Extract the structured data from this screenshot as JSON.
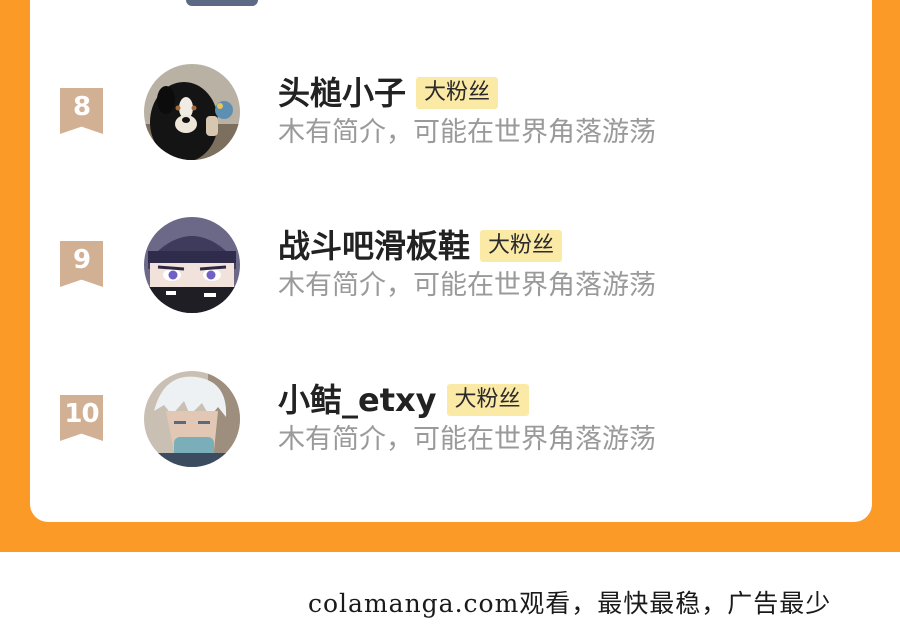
{
  "ranking": {
    "entries": [
      {
        "rank": "8",
        "name": "头槌小子",
        "badge": "大粉丝",
        "bio": "木有简介，可能在世界角落游荡",
        "avatar_icon": "dog-avatar-icon"
      },
      {
        "rank": "9",
        "name": "战斗吧滑板鞋",
        "badge": "大粉丝",
        "bio": "木有简介，可能在世界角落游荡",
        "avatar_icon": "anime-boy-beanie-avatar-icon"
      },
      {
        "rank": "10",
        "name": "小鲒_etxy",
        "badge": "大粉丝",
        "bio": "木有简介，可能在世界角落游荡",
        "avatar_icon": "anime-boy-white-hair-avatar-icon"
      }
    ]
  },
  "footer": {
    "watermark": "colamanga.com观看，最快最稳，广告最少"
  },
  "colors": {
    "frame": "#fb9a26",
    "card": "#ffffff",
    "rank_badge": "#d2b094",
    "fan_badge": "#fbe9a6",
    "name_text": "#222222",
    "bio_text": "#9a9a9a"
  }
}
